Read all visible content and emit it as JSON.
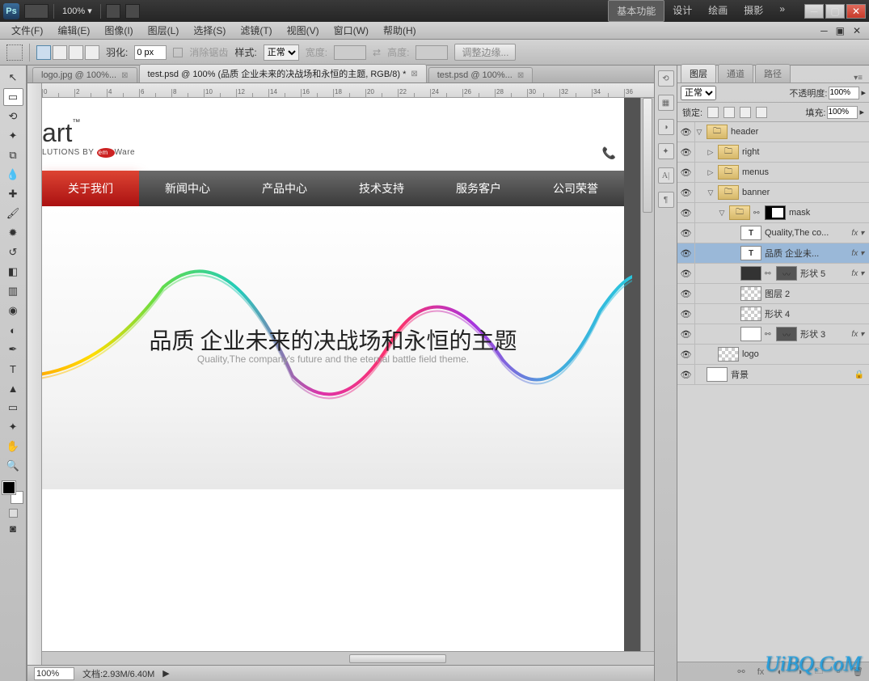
{
  "topbar": {
    "zoom": "100% ▾",
    "workspaces": [
      "基本功能",
      "设计",
      "绘画",
      "摄影"
    ],
    "active_workspace": 0
  },
  "menubar": [
    "文件(F)",
    "编辑(E)",
    "图像(I)",
    "图层(L)",
    "选择(S)",
    "滤镜(T)",
    "视图(V)",
    "窗口(W)",
    "帮助(H)"
  ],
  "optionsbar": {
    "feather_label": "羽化:",
    "feather_value": "0 px",
    "antialias": "消除锯齿",
    "style_label": "样式:",
    "style_value": "正常",
    "width_label": "宽度:",
    "height_label": "高度:",
    "refine_btn": "调整边缘..."
  },
  "doctabs": [
    {
      "label": "logo.jpg @ 100%...",
      "active": false
    },
    {
      "label": "test.psd @ 100% (品质 企业未来的决战场和永恒的主题, RGB/8) *",
      "active": true
    },
    {
      "label": "test.psd @ 100%...",
      "active": false
    }
  ],
  "site": {
    "logo": "art",
    "tm": "™",
    "byline_prefix": "LUTIONS BY ",
    "byline_brand": "em",
    "byline_suffix": "Ware",
    "nav": [
      "关于我们",
      "新闻中心",
      "产品中心",
      "技术支持",
      "服务客户",
      "公司荣誉"
    ],
    "nav_active": 0,
    "banner_title": "品质 企业未来的决战场和永恒的主题",
    "banner_sub": "Quality,The company's future and the eternal battle field theme."
  },
  "statusbar": {
    "zoom": "100%",
    "docinfo": "文档:2.93M/6.40M"
  },
  "panels": {
    "tabs": [
      "图层",
      "通道",
      "路径"
    ],
    "active_tab": 0,
    "blend_mode": "正常",
    "opacity_label": "不透明度:",
    "opacity_value": "100%",
    "lock_label": "锁定:",
    "fill_label": "填充:",
    "fill_value": "100%",
    "layers": [
      {
        "eye": true,
        "indent": 0,
        "arrow": "▽",
        "thumb": "folder",
        "name": "header"
      },
      {
        "eye": true,
        "indent": 1,
        "arrow": "▷",
        "thumb": "folder",
        "name": "right"
      },
      {
        "eye": true,
        "indent": 1,
        "arrow": "▷",
        "thumb": "folder",
        "name": "menus"
      },
      {
        "eye": true,
        "indent": 1,
        "arrow": "▽",
        "thumb": "folder",
        "name": "banner"
      },
      {
        "eye": true,
        "indent": 2,
        "arrow": "▽",
        "thumb": "folder",
        "link": true,
        "mask": true,
        "name": "mask"
      },
      {
        "eye": true,
        "indent": 3,
        "arrow": "",
        "thumb": "text",
        "name": "Quality,The co...",
        "fx": true
      },
      {
        "eye": true,
        "indent": 3,
        "arrow": "",
        "thumb": "text",
        "name": "品质 企业未...",
        "fx": true,
        "selected": true
      },
      {
        "eye": true,
        "indent": 3,
        "arrow": "",
        "thumb": "shape-dark",
        "link": true,
        "mask2": "shape",
        "name": "形状 5",
        "fx": true
      },
      {
        "eye": true,
        "indent": 3,
        "arrow": "",
        "thumb": "checker",
        "name": "图层 2"
      },
      {
        "eye": true,
        "indent": 3,
        "arrow": "",
        "thumb": "checker",
        "name": "形状 4"
      },
      {
        "eye": true,
        "indent": 3,
        "arrow": "",
        "thumb": "shape-white",
        "link": true,
        "mask2": "shape",
        "name": "形状 3",
        "fx": true
      },
      {
        "eye": true,
        "indent": 1,
        "arrow": "",
        "thumb": "checker",
        "name": "logo"
      },
      {
        "eye": true,
        "indent": 0,
        "arrow": "",
        "thumb": "shape-white",
        "name": "背景",
        "locked": true
      }
    ]
  },
  "watermark": "UiBQ.CoM"
}
